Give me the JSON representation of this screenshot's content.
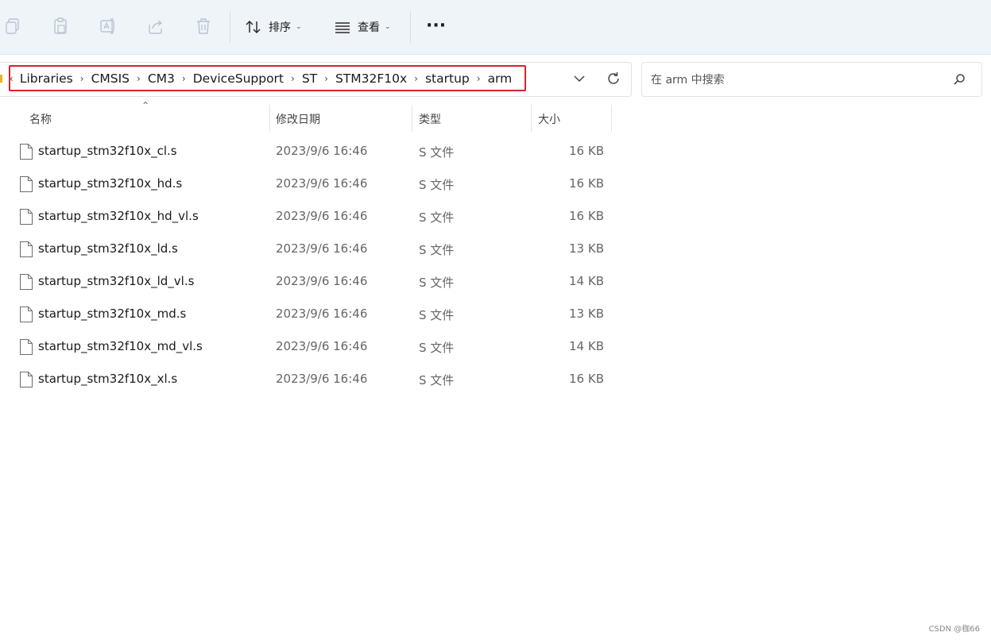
{
  "toolbar": {
    "sort_label": "排序",
    "view_label": "查看",
    "more_label": "···",
    "icons": [
      "copy-icon",
      "paste-icon",
      "rename-icon",
      "share-icon",
      "delete-icon",
      "sort-icon",
      "view-icon"
    ]
  },
  "breadcrumb": {
    "items": [
      "Libraries",
      "CMSIS",
      "CM3",
      "DeviceSupport",
      "ST",
      "STM32F10x",
      "startup",
      "arm"
    ],
    "lead": "‹",
    "separator": "›",
    "highlight_color": "#d9212b"
  },
  "search": {
    "placeholder": "在 arm 中搜索"
  },
  "columns": {
    "name": "名称",
    "modified": "修改日期",
    "type": "类型",
    "size": "大小"
  },
  "files": [
    {
      "name": "startup_stm32f10x_cl.s",
      "date": "2023/9/6 16:46",
      "type": "S 文件",
      "size": "16 KB"
    },
    {
      "name": "startup_stm32f10x_hd.s",
      "date": "2023/9/6 16:46",
      "type": "S 文件",
      "size": "16 KB"
    },
    {
      "name": "startup_stm32f10x_hd_vl.s",
      "date": "2023/9/6 16:46",
      "type": "S 文件",
      "size": "16 KB"
    },
    {
      "name": "startup_stm32f10x_ld.s",
      "date": "2023/9/6 16:46",
      "type": "S 文件",
      "size": "13 KB"
    },
    {
      "name": "startup_stm32f10x_ld_vl.s",
      "date": "2023/9/6 16:46",
      "type": "S 文件",
      "size": "14 KB"
    },
    {
      "name": "startup_stm32f10x_md.s",
      "date": "2023/9/6 16:46",
      "type": "S 文件",
      "size": "13 KB"
    },
    {
      "name": "startup_stm32f10x_md_vl.s",
      "date": "2023/9/6 16:46",
      "type": "S 文件",
      "size": "14 KB"
    },
    {
      "name": "startup_stm32f10x_xl.s",
      "date": "2023/9/6 16:46",
      "type": "S 文件",
      "size": "16 KB"
    }
  ],
  "watermark": "CSDN @枷66"
}
